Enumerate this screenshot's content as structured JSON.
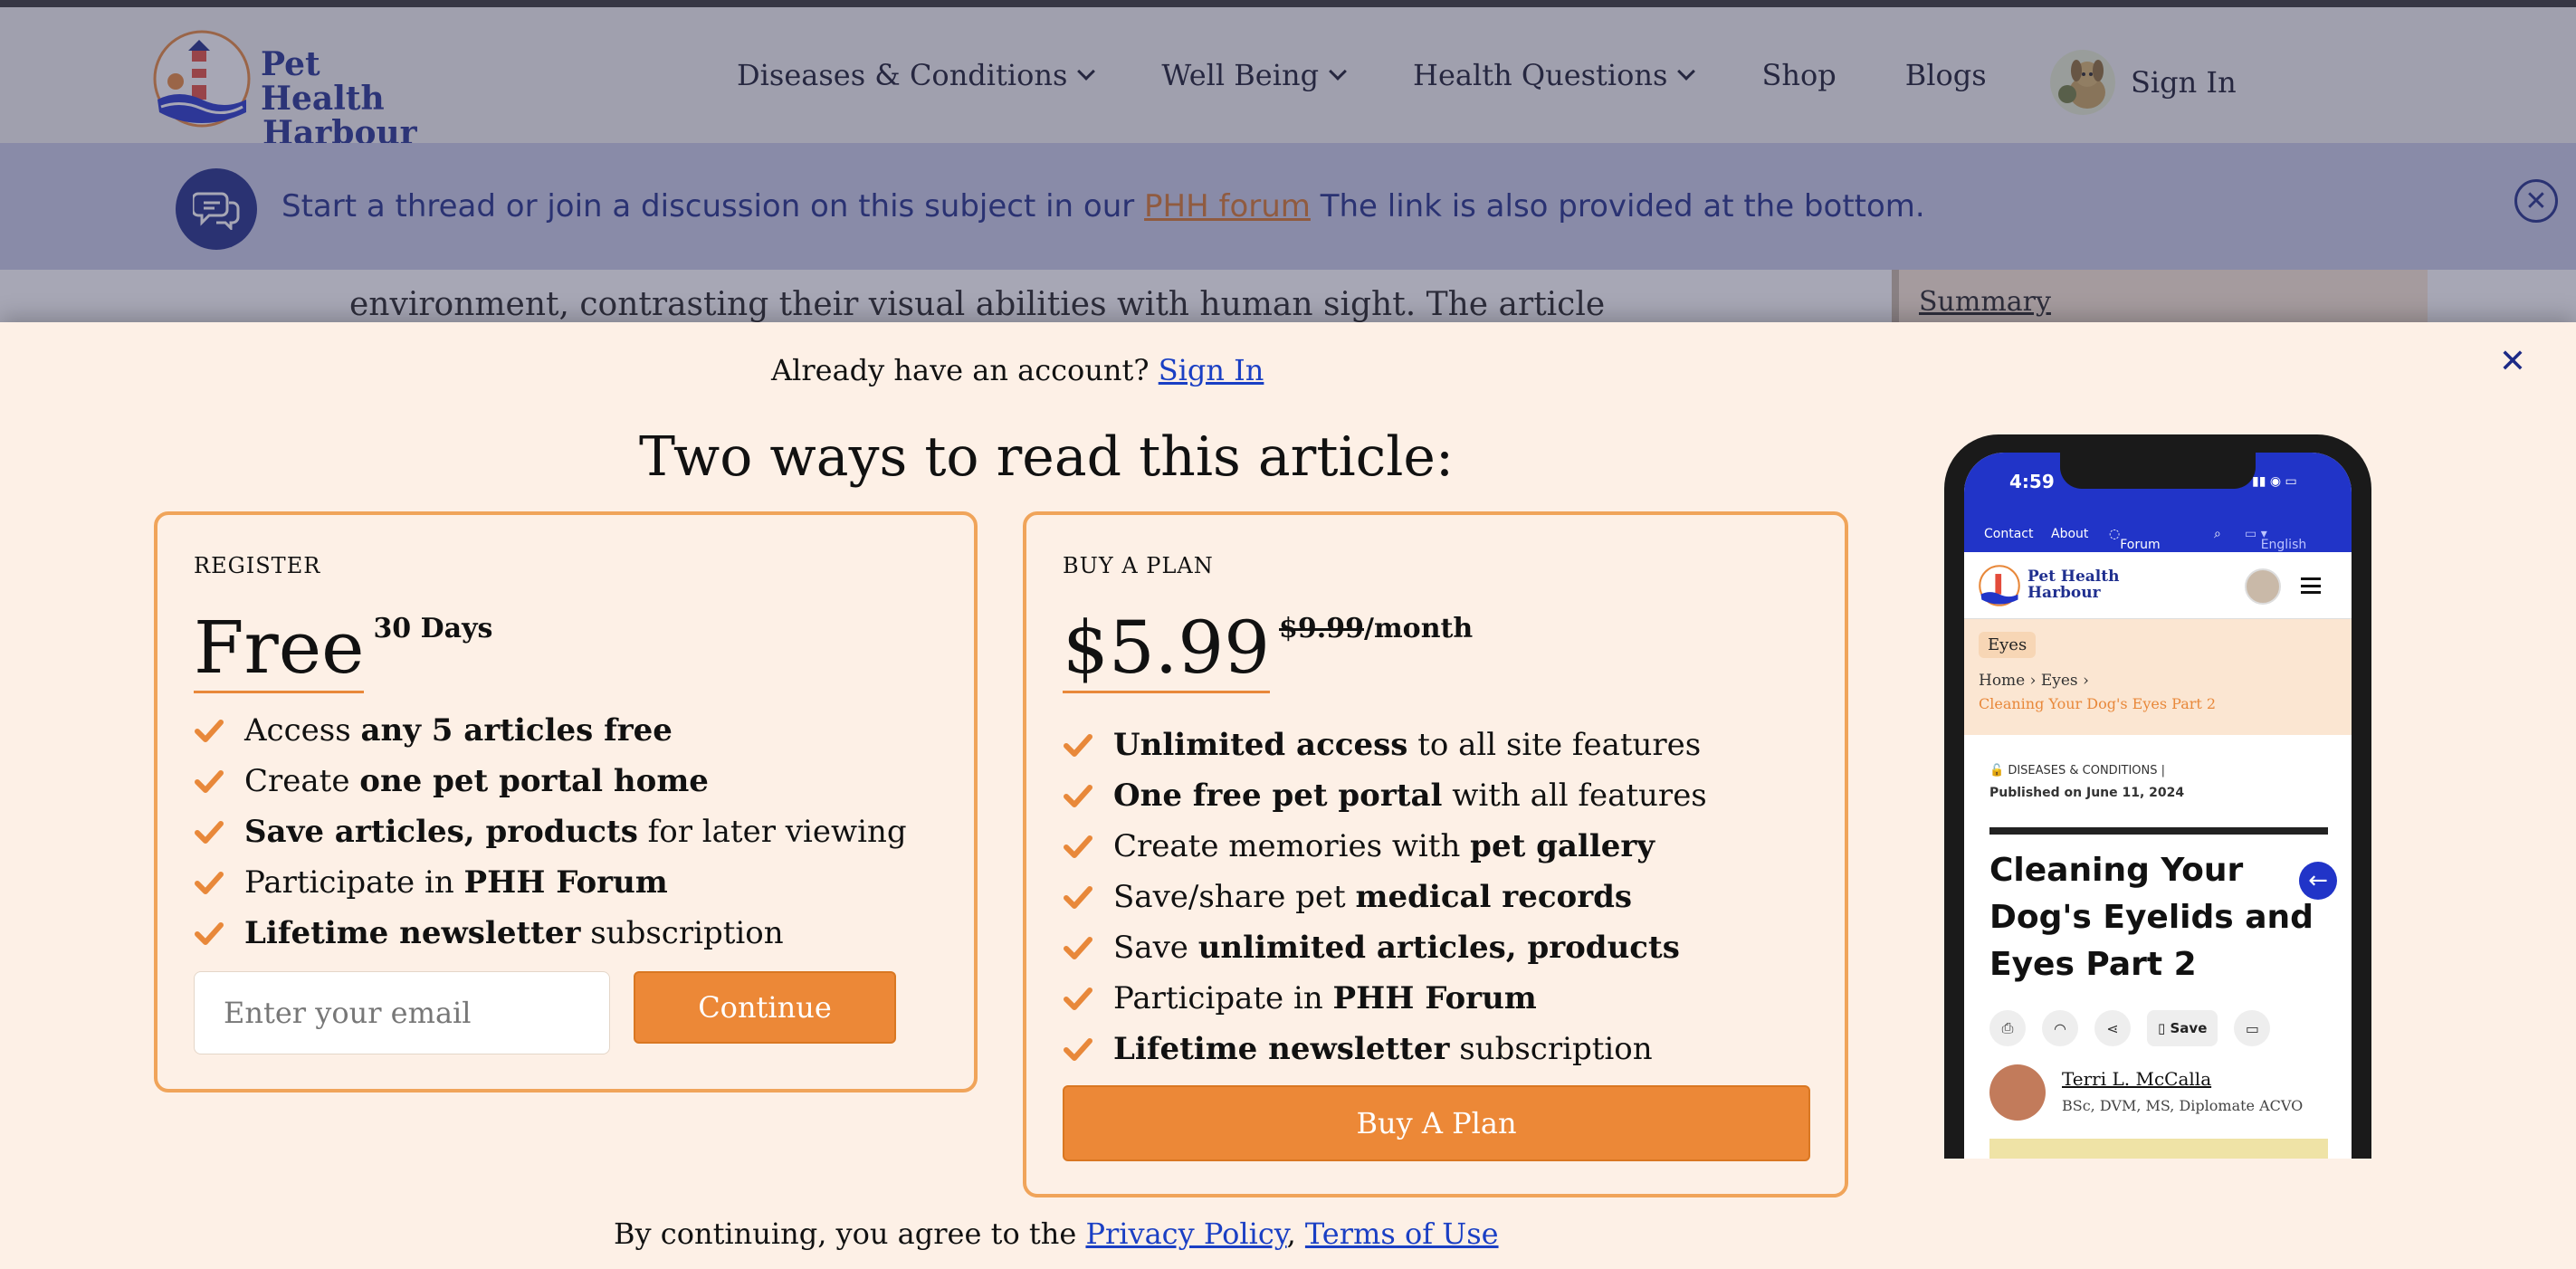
{
  "site": {
    "logo_line1": "Pet Health",
    "logo_line2": "Harbour",
    "nav": [
      {
        "label": "Diseases & Conditions"
      },
      {
        "label": "Well Being"
      },
      {
        "label": "Health Questions"
      },
      {
        "label": "Shop"
      },
      {
        "label": "Blogs"
      }
    ],
    "sign_in": "Sign In"
  },
  "banner": {
    "text_before": "Start a thread or join a discussion on this subject in our ",
    "link": "PHH forum",
    "text_after": " The link is also provided at the bottom."
  },
  "article": {
    "visible_line": "environment, contrasting their visual abilities with human sight. The article",
    "toc_summary": "Summary"
  },
  "modal": {
    "already_text": "Already have an account? ",
    "already_link": "Sign In",
    "title": "Two ways to read this article:",
    "register": {
      "label": "REGISTER",
      "price": "Free",
      "price_sup": "30 Days",
      "features": [
        {
          "pre": "Access ",
          "bold": "any 5 articles free",
          "post": ""
        },
        {
          "pre": "Create ",
          "bold": "one pet portal home",
          "post": ""
        },
        {
          "pre": "",
          "bold": "Save articles, products",
          "post": " for later viewing"
        },
        {
          "pre": "Participate in ",
          "bold": "PHH Forum",
          "post": ""
        },
        {
          "pre": "",
          "bold": "Lifetime newsletter",
          "post": " subscription"
        }
      ],
      "email_placeholder": "Enter your email",
      "continue": "Continue"
    },
    "plan": {
      "label": "BUY A PLAN",
      "price": "$5.99",
      "price_old": "$9.99",
      "price_period": "/month",
      "features": [
        {
          "pre": "",
          "bold": "Unlimited access",
          "post": " to all site features"
        },
        {
          "pre": "",
          "bold": "One free pet portal",
          "post": " with all features"
        },
        {
          "pre": "Create memories with ",
          "bold": "pet gallery",
          "post": ""
        },
        {
          "pre": "Save/share pet ",
          "bold": "medical records",
          "post": ""
        },
        {
          "pre": "Save ",
          "bold": "unlimited articles, products",
          "post": ""
        },
        {
          "pre": "Participate in ",
          "bold": "PHH Forum",
          "post": ""
        },
        {
          "pre": "",
          "bold": "Lifetime newsletter",
          "post": " subscription"
        }
      ],
      "button": "Buy A Plan"
    },
    "terms_pre": "By continuing, you agree to the ",
    "privacy": "Privacy Policy",
    "comma": ",",
    "terms": "Terms of Use"
  },
  "phone": {
    "time": "4:59",
    "topnav": [
      "Contact",
      "About",
      "Forum",
      "English"
    ],
    "logo_line1": "Pet Health",
    "logo_line2": "Harbour",
    "tag": "Eyes",
    "crumb_home": "Home",
    "crumb_eyes": "Eyes",
    "crumb_current": "Cleaning Your Dog's Eyes Part 2",
    "category": "DISEASES & CONDITIONS",
    "published": "Published on June 11, 2024",
    "title": "Cleaning Your Dog's Eyelids and Eyes Part 2",
    "save": "Save",
    "author": "Terri L. McCalla",
    "credentials": "BSc, DVM, MS, Diplomate ACVO"
  },
  "colors": {
    "brand_blue": "#1d2a86",
    "accent_orange": "#ec8837",
    "modal_bg": "#fdf0e6"
  }
}
